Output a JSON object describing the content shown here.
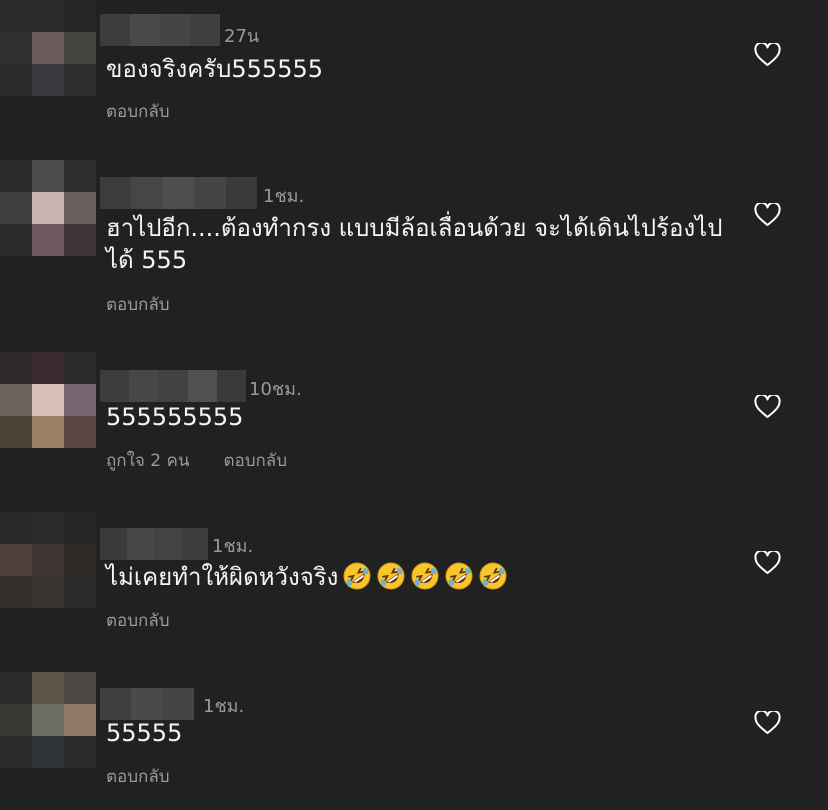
{
  "comments": [
    {
      "time": "27น",
      "text": "ของจริงครับ555555",
      "reply_label": "ตอบกลับ",
      "avatar_colors": [
        "#2b2b2d",
        "#2a2a2c",
        "#262628",
        "#2f2f31",
        "#6b5b5c",
        "#47453f",
        "#2a2a2c",
        "#3c3a40",
        "#2e2e30"
      ],
      "username_colors": [
        "#3d3d3d",
        "#4a4a4a",
        "#454545",
        "#3f3f3f"
      ]
    },
    {
      "time": "1ชม.",
      "text_lines": [
        "ฮาไปอีก....ต้องทำกรง แบบมีล้อเลื่อนด้วย จะได้เดินไปร้องไป",
        "ได้ 555"
      ],
      "reply_label": "ตอบกลับ",
      "avatar_colors": [
        "#2a2a2a",
        "#4c4b4b",
        "#2e2e2e",
        "#3e3e3e",
        "#c7b4b1",
        "#6b6060",
        "#2a2a2a",
        "#6e5960",
        "#3d3536"
      ],
      "username_colors": [
        "#3c3c3c",
        "#464646",
        "#4f4f4f",
        "#454545",
        "#3a3a3a"
      ]
    },
    {
      "time": "10ชม.",
      "text": "555555555",
      "likes_label": "ถูกใจ 2 คน",
      "reply_label": "ตอบกลับ",
      "avatar_colors": [
        "#2f2a2b",
        "#3a2b33",
        "#2c2a2c",
        "#6e635a",
        "#d8bfb8",
        "#7a6670",
        "#4a4236",
        "#9a8064",
        "#5a4644"
      ],
      "username_colors": [
        "#3d3d3d",
        "#474747",
        "#424242",
        "#505050",
        "#3a3a3a"
      ]
    },
    {
      "time": "1ชม.",
      "text": "ไม่เคยทำให้ผิดหวังจริง",
      "emoji_count": 5,
      "emoji_name": "rolling-on-floor-laughing-emoji",
      "reply_label": "ตอบกลับ",
      "avatar_colors": [
        "#2a2827",
        "#2b2b2b",
        "#272727",
        "#4e4139",
        "#3c3531",
        "#2d2a28",
        "#35302d",
        "#3a3431",
        "#2b2a29"
      ],
      "username_colors": [
        "#3a3a3a",
        "#474747",
        "#434343",
        "#3d3d3d"
      ]
    },
    {
      "time": "1ชม.",
      "text": "55555",
      "reply_label": "ตอบกลับ",
      "avatar_colors": [
        "#2a2a2a",
        "#5c5448",
        "#4b4844",
        "#3a3834",
        "#6c6e66",
        "#8e7a66",
        "#2b2b2b",
        "#303439",
        "#2c2b2a"
      ],
      "username_colors": [
        "#3f3f3f",
        "#4a4a4a",
        "#454545"
      ]
    }
  ],
  "colors": {
    "background": "#212121",
    "text": "#f4f4f4",
    "muted": "#9a9a9a",
    "heart_stroke": "#ffffff"
  }
}
